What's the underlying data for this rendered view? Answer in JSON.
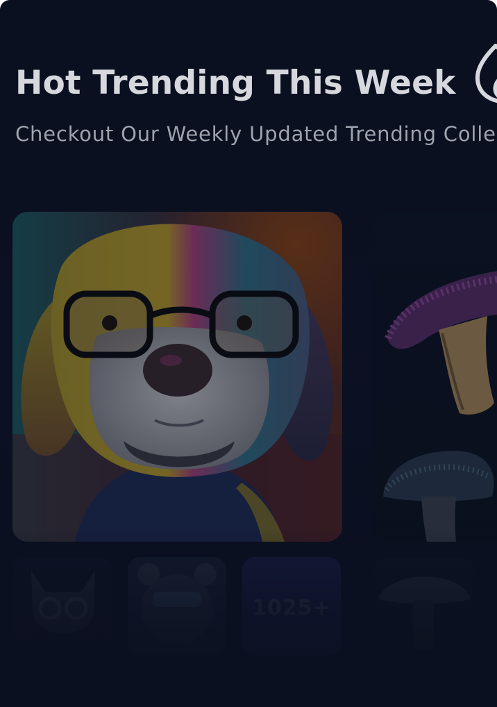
{
  "header": {
    "title": "Hot Trending This Week",
    "subtitle": "Checkout Our Weekly Updated Trending Colle",
    "title_icon": "flame-icon"
  },
  "featured_cards": [
    {
      "name": "dog-with-glasses-artwork"
    },
    {
      "name": "mushroom-artwork"
    }
  ],
  "thumbnails": [
    {
      "name": "cat-artwork"
    },
    {
      "name": "bear-artwork"
    },
    {
      "name": "more-count",
      "label": "1025+"
    },
    {
      "name": "mushroom-small-artwork"
    }
  ],
  "colors": {
    "background": "#0b1020",
    "title": "#d6d8de",
    "subtitle": "#9ea3ad"
  }
}
